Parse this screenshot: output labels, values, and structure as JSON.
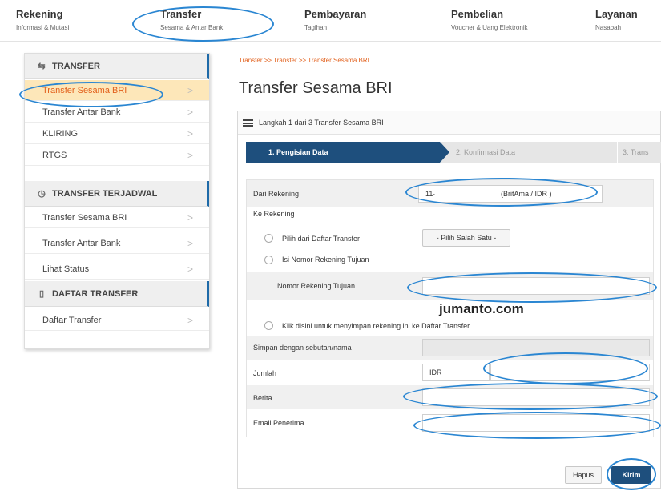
{
  "nav": {
    "items": [
      {
        "title": "Rekening",
        "sub": "Informasi & Mutasi"
      },
      {
        "title": "Transfer",
        "sub": "Sesama & Antar Bank"
      },
      {
        "title": "Pembayaran",
        "sub": "Tagihan"
      },
      {
        "title": "Pembelian",
        "sub": "Voucher & Uang Elektronik"
      },
      {
        "title": "Layanan",
        "sub": "Nasabah"
      }
    ]
  },
  "sidebar": {
    "sections": [
      {
        "title": "TRANSFER",
        "icon": "transfer-icon",
        "items": [
          "Transfer Sesama BRI",
          "Transfer Antar Bank",
          "KLIRING",
          "RTGS"
        ]
      },
      {
        "title": "TRANSFER TERJADWAL",
        "icon": "clock-icon",
        "items": [
          "Transfer Sesama BRI",
          "Transfer Antar Bank",
          "Lihat Status"
        ]
      },
      {
        "title": "DAFTAR TRANSFER",
        "icon": "document-icon",
        "items": [
          "Daftar Transfer"
        ]
      }
    ],
    "active_item": "Transfer Sesama BRI",
    "chevron": ">"
  },
  "breadcrumb": "Transfer >> Transfer >> Transfer Sesama BRI",
  "page_title": "Transfer Sesama BRI",
  "panel": {
    "header": "Langkah 1 dari 3 Transfer Sesama BRI",
    "steps": [
      "1. Pengisian Data",
      "2. Konfirmasi Data",
      "3. Trans"
    ]
  },
  "form": {
    "dari_rekening_label": "Dari Rekening",
    "dari_rekening_value": "11·",
    "dari_rekening_type": "(BritAma / IDR )",
    "ke_rekening_label": "Ke Rekening",
    "option_daftar_label": "Pilih dari Daftar Transfer",
    "option_daftar_select": "- Pilih Salah Satu -",
    "option_nomor_label": "Isi Nomor Rekening Tujuan",
    "nomor_rekening_label": "Nomor Rekening Tujuan",
    "nomor_rekening_value": "",
    "save_option_label": "Klik disini untuk menyimpan rekening ini ke Daftar Transfer",
    "simpan_label": "Simpan dengan sebutan/nama",
    "simpan_value": "",
    "jumlah_label": "Jumlah",
    "currency": "IDR",
    "jumlah_value": "",
    "berita_label": "Berita",
    "berita_value": "",
    "email_label": "Email Penerima",
    "email_value": ""
  },
  "actions": {
    "reset": "Hapus",
    "submit": "Kirim"
  },
  "watermark": "jumanto.com",
  "colors": {
    "accent": "#1e4f7d",
    "highlight": "#fde7b9",
    "link": "#e2601c",
    "annotation": "#2a86d2"
  }
}
